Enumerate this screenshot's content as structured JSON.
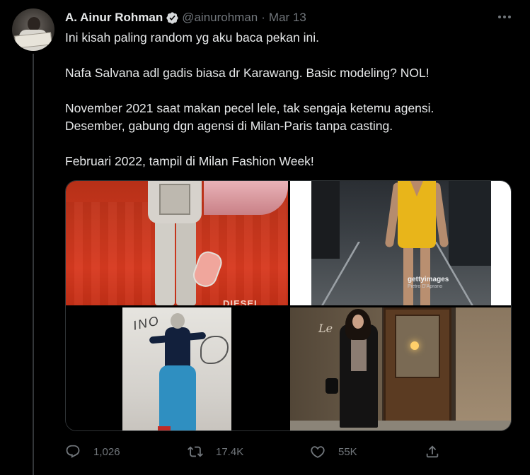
{
  "tweet": {
    "author_name": "A. Ainur Rohman",
    "handle": "@ainurohman",
    "separator": "·",
    "date": "Mar 13",
    "lines": [
      "Ini kisah paling random yg aku baca pekan ini.",
      "",
      "Nafa Salvana adl gadis biasa dr Karawang. Basic modeling? NOL!",
      "",
      "November 2021 saat makan pecel lele, tak sengaja ketemu agensi.",
      "Desember, gabung dgn agensi di Milan-Paris tanpa casting.",
      "",
      "Februari 2022, tampil di Milan Fashion Week!"
    ]
  },
  "media": {
    "photo_1_text": "DIESEL",
    "photo_2_text": "gettyimages",
    "photo_2_credit": "Pietro D'Aprano",
    "photo_3_text": "INO",
    "photo_4_text": "Le"
  },
  "actions": {
    "reply_count": "1,026",
    "retweet_count": "17.4K",
    "like_count": "55K"
  },
  "colors": {
    "background": "#000000",
    "text": "#e7e9ea",
    "secondary": "#71767b",
    "verified": "#d6d9db"
  },
  "icons": {
    "verified": "verified-badge-icon",
    "more": "more-icon",
    "reply": "reply-icon",
    "retweet": "retweet-icon",
    "like": "heart-icon",
    "share": "share-icon"
  }
}
